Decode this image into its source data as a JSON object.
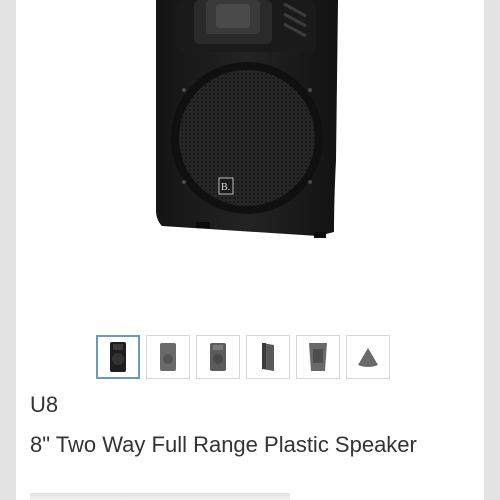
{
  "product": {
    "code": "U8",
    "title": "8\" Two Way Full Range Plastic Speaker",
    "logo_text": "B."
  },
  "gallery": {
    "thumbnails": [
      {
        "name": "front",
        "active": true
      },
      {
        "name": "front-angle",
        "active": false
      },
      {
        "name": "front-straight",
        "active": false
      },
      {
        "name": "side",
        "active": false
      },
      {
        "name": "rear",
        "active": false
      },
      {
        "name": "top",
        "active": false
      }
    ]
  },
  "colors": {
    "speaker_body": "#1c1c1c",
    "grille": "#2b2b2b",
    "active_thumb_border": "#6a9ab5",
    "text": "#333333"
  }
}
